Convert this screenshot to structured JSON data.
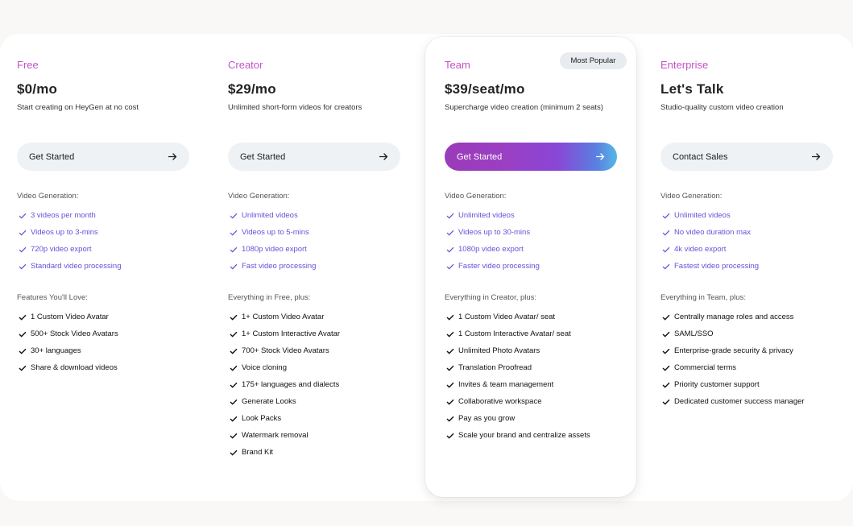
{
  "badge": "Most Popular",
  "plans": [
    {
      "name": "Free",
      "price": "$0/mo",
      "desc": "Start creating on HeyGen at no cost",
      "cta": "Get Started",
      "gen_title": "Video Generation:",
      "gen": [
        "3 videos per month",
        "Videos up to 3-mins",
        "720p video export",
        "Standard video processing"
      ],
      "feat_title": "Features You'll Love:",
      "features": [
        "1 Custom Video Avatar",
        "500+ Stock Video Avatars",
        "30+ languages",
        "Share & download videos"
      ]
    },
    {
      "name": "Creator",
      "price": "$29/mo",
      "desc": "Unlimited short-form videos for creators",
      "cta": "Get Started",
      "gen_title": "Video Generation:",
      "gen": [
        "Unlimited videos",
        "Videos up to 5-mins",
        "1080p video export",
        "Fast video processing"
      ],
      "feat_title": "Everything in Free, plus:",
      "features": [
        "1+ Custom Video Avatar",
        "1+ Custom Interactive Avatar",
        "700+ Stock Video Avatars",
        "Voice cloning",
        "175+ languages and dialects",
        "Generate Looks",
        "Look Packs",
        "Watermark removal",
        "Brand Kit"
      ]
    },
    {
      "name": "Team",
      "price": "$39/seat/mo",
      "desc": "Supercharge video creation (minimum 2 seats)",
      "cta": "Get Started",
      "gen_title": "Video Generation:",
      "gen": [
        "Unlimited videos",
        "Videos up to 30-mins",
        "1080p video export",
        "Faster video processing"
      ],
      "feat_title": "Everything in Creator, plus:",
      "features": [
        "1 Custom Video Avatar/ seat",
        "1 Custom Interactive Avatar/ seat",
        "Unlimited Photo Avatars",
        "Translation Proofread",
        "Invites & team management",
        "Collaborative workspace",
        "Pay as you grow",
        "Scale your brand and centralize assets"
      ]
    },
    {
      "name": "Enterprise",
      "price": "Let's Talk",
      "desc": "Studio-quality custom video creation",
      "cta": "Contact Sales",
      "gen_title": "Video Generation:",
      "gen": [
        "Unlimited videos",
        "No video duration max",
        "4k video export",
        "Fastest video processing"
      ],
      "feat_title": "Everything in Team, plus:",
      "features": [
        "Centrally manage roles and access",
        "SAML/SSO",
        "Enterprise-grade security & privacy",
        "Commercial terms",
        "Priority customer support",
        "Dedicated customer success manager"
      ]
    }
  ],
  "colors": {
    "accent": "#c353c7",
    "generation_text": "#6a4fd8",
    "button_bg": "#eff2f5"
  },
  "icons": {
    "check": "check-icon",
    "arrow": "arrow-right-icon"
  }
}
